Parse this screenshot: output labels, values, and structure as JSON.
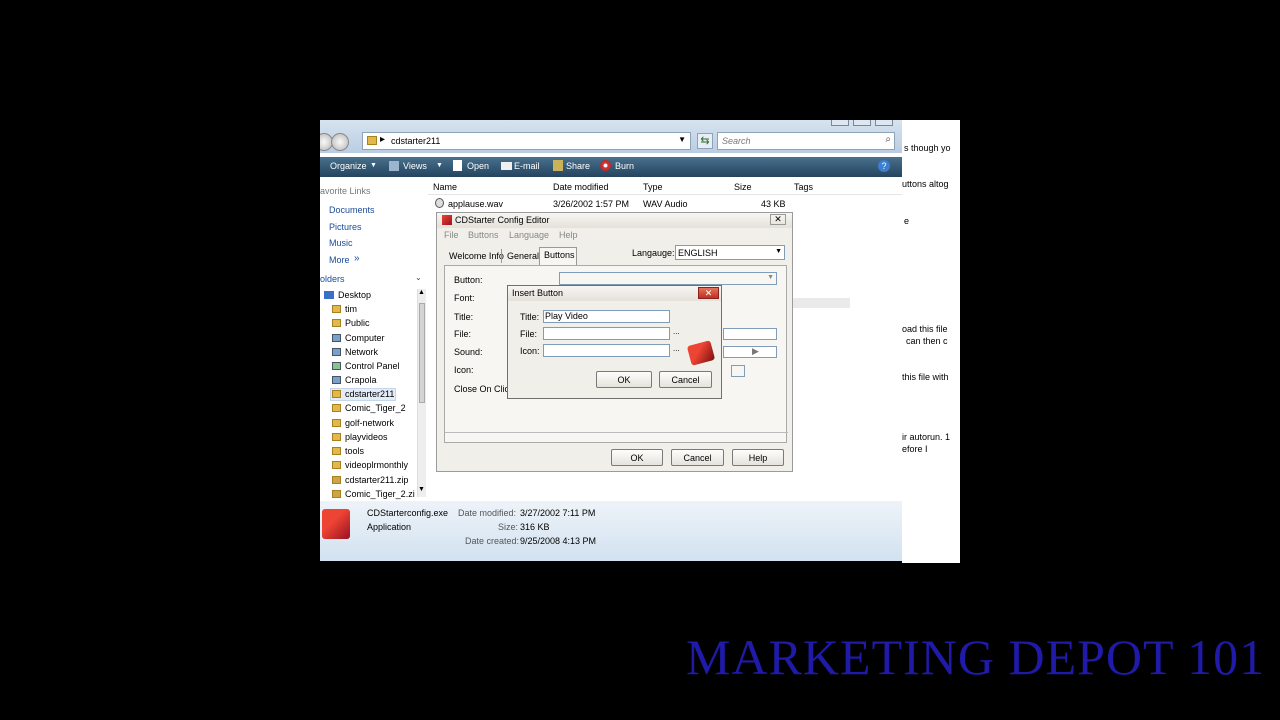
{
  "explorer": {
    "address": "cdstarter211",
    "search_placeholder": "Search",
    "toolbar": [
      "Organize",
      "Views",
      "Open",
      "E-mail",
      "Share",
      "Burn"
    ],
    "favorites_header": "avorite Links",
    "favorites": [
      "Documents",
      "Pictures",
      "Music",
      "More"
    ],
    "folders_header": "olders",
    "tree": [
      "Desktop",
      "tim",
      "Public",
      "Computer",
      "Network",
      "Control Panel",
      "Crapola",
      "cdstarter211",
      "Comic_Tiger_2",
      "golf-network",
      "playvideos",
      "tools",
      "videoplrmonthly",
      "cdstarter211.zip",
      "Comic_Tiger_2.zi"
    ],
    "columns": [
      "Name",
      "Date modified",
      "Type",
      "Size",
      "Tags"
    ],
    "file_row": {
      "name": "applause.wav",
      "date": "3/26/2002 1:57 PM",
      "type": "WAV Audio",
      "size": "43 KB"
    },
    "details": {
      "filename": "CDStarterconfig.exe",
      "type": "Application",
      "date_modified_label": "Date modified:",
      "date_modified": "3/27/2002 7:11 PM",
      "size_label": "Size:",
      "size": "316 KB",
      "date_created_label": "Date created:",
      "date_created": "9/25/2008 4:13 PM"
    }
  },
  "docpanel": [
    "s though yo",
    "uttons altog",
    "e",
    "oad this file",
    "can then c",
    "this file with",
    "ir autorun. 1",
    "efore I"
  ],
  "cdstarter": {
    "title": "CDStarter Config Editor",
    "menu": [
      "File",
      "Buttons",
      "Language",
      "Help"
    ],
    "tabs": [
      "Welcome Info",
      "General",
      "Buttons"
    ],
    "language_label": "Langauge:",
    "language_value": "ENGLISH",
    "labels": [
      "Button:",
      "Font:",
      "Title:",
      "File:",
      "Sound:",
      "Icon:",
      "Close On Click"
    ],
    "ok": "OK",
    "cancel": "Cancel",
    "help": "Help"
  },
  "insert": {
    "title": "Insert Button",
    "title_label": "Title:",
    "title_value": "Play Video",
    "file_label": "File:",
    "icon_label": "Icon:",
    "browse": "...",
    "ok": "OK",
    "cancel": "Cancel"
  },
  "brand": "MARKETING DEPOT 101",
  "colors": {
    "brand": "#1f1aa8",
    "toolbar": "#2f5574"
  }
}
